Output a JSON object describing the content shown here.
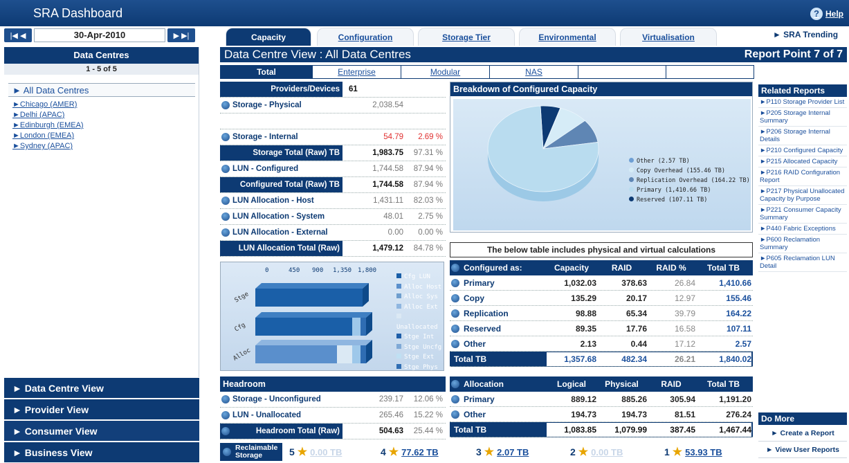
{
  "app": {
    "title": "SRA Dashboard",
    "help": "Help"
  },
  "date": "30-Apr-2010",
  "tabs": [
    "Capacity",
    "Configuration",
    "Storage Tier",
    "Environmental",
    "Virtualisation"
  ],
  "trending": "► SRA Trending",
  "left": {
    "header": "Data Centres",
    "count": "1 - 5 of 5",
    "all": "► All Data Centres",
    "locations": [
      "►Chicago (AMER)",
      "►Delhi (APAC)",
      "►Edinburgh (EMEA)",
      "►London (EMEA)",
      "►Sydney (APAC)"
    ],
    "views": [
      "► Data Centre View",
      "► Provider View",
      "► Consumer View",
      "► Business View"
    ]
  },
  "view_title": "Data Centre View : All Data Centres",
  "report_point": "Report Point  7  of  7",
  "subtabs": [
    "Total",
    "Enterprise",
    "Modular",
    "NAS",
    "",
    ""
  ],
  "main": {
    "providers_label": "Providers/Devices",
    "providers_value": "61",
    "rows": [
      {
        "label": "Storage - Physical",
        "v1": "2,038.54",
        "v2": ""
      },
      {
        "label": "Storage - Internal",
        "v1": "54.79",
        "v2": "2.69 %"
      },
      {
        "label": "Storage Total (Raw) TB",
        "v1": "1,983.75",
        "v2": "97.31 %"
      },
      {
        "label": "LUN - Configured",
        "v1": "1,744.58",
        "v2": "87.94 %"
      },
      {
        "label": "Configured Total (Raw) TB",
        "v1": "1,744.58",
        "v2": "87.94 %"
      },
      {
        "label": "LUN Allocation - Host",
        "v1": "1,431.11",
        "v2": "82.03 %"
      },
      {
        "label": "LUN Allocation - System",
        "v1": "48.01",
        "v2": "2.75 %"
      },
      {
        "label": "LUN Allocation - External",
        "v1": "0.00",
        "v2": "0.00 %"
      },
      {
        "label": "LUN Allocation Total (Raw)",
        "v1": "1,479.12",
        "v2": "84.78 %"
      }
    ]
  },
  "breakdown": {
    "title": "Breakdown of Configured Capacity",
    "legend": [
      "Other (2.57 TB)",
      "Copy Overhead (155.46 TB)",
      "Replication Overhead (164.22 TB)",
      "Primary (1,410.66 TB)",
      "Reserved (107.11 TB)"
    ],
    "colors": [
      "#6e9fd4",
      "#d6ecf7",
      "#5f86b4",
      "#b9dcef",
      "#0d3a73"
    ]
  },
  "chart_data": {
    "type": "pie",
    "title": "Breakdown of Configured Capacity",
    "categories": [
      "Other",
      "Copy Overhead",
      "Replication Overhead",
      "Primary",
      "Reserved"
    ],
    "values": [
      2.57,
      155.46,
      164.22,
      1410.66,
      107.11
    ]
  },
  "bar": {
    "ticks": [
      "0",
      "450",
      "900",
      "1,350",
      "1,800"
    ],
    "cats": [
      "Stge",
      "Cfg",
      "Alloc"
    ],
    "legend": [
      "Cfg LUN",
      "Alloc Host",
      "Alloc Sys",
      "Alloc Ext",
      "Unallocated",
      "Stge Int",
      "Stge Uncfg",
      "Stge Ext",
      "Stge Phys"
    ],
    "colors": [
      "#1a5fa8",
      "#5a8fcc",
      "#6e9ece",
      "#8fb6e0",
      "#dbe9f4",
      "#1e5ea9",
      "#7fa9d6",
      "#bfe0f3",
      "#2f6db3"
    ]
  },
  "note": "The below table includes physical and virtual calculations",
  "configured": {
    "headers": [
      "Configured as:",
      "Capacity",
      "RAID",
      "RAID %",
      "Total TB"
    ],
    "rows": [
      [
        "Primary",
        "1,032.03",
        "378.63",
        "26.84",
        "1,410.66"
      ],
      [
        "Copy",
        "135.29",
        "20.17",
        "12.97",
        "155.46"
      ],
      [
        "Replication",
        "98.88",
        "65.34",
        "39.79",
        "164.22"
      ],
      [
        "Reserved",
        "89.35",
        "17.76",
        "16.58",
        "107.11"
      ],
      [
        "Other",
        "2.13",
        "0.44",
        "17.12",
        "2.57"
      ]
    ],
    "total": [
      "Total TB",
      "1,357.68",
      "482.34",
      "26.21",
      "1,840.02"
    ]
  },
  "allocation": {
    "headers": [
      "Allocation",
      "Logical",
      "Physical",
      "RAID",
      "Total TB"
    ],
    "rows": [
      [
        "Primary",
        "889.12",
        "885.26",
        "305.94",
        "1,191.20"
      ],
      [
        "Other",
        "194.73",
        "194.73",
        "81.51",
        "276.24"
      ]
    ],
    "total": [
      "Total TB",
      "1,083.85",
      "1,079.99",
      "387.45",
      "1,467.44"
    ]
  },
  "headroom": {
    "title": "Headroom",
    "rows": [
      {
        "label": "Storage - Unconfigured",
        "v1": "239.17",
        "v2": "12.06 %"
      },
      {
        "label": "LUN - Unallocated",
        "v1": "265.46",
        "v2": "15.22 %"
      },
      {
        "label": "Headroom Total (Raw)",
        "v1": "504.63",
        "v2": "25.44 %"
      }
    ]
  },
  "reclaim": {
    "label": "Reclaimable Storage",
    "items": [
      {
        "n": "5",
        "v": "0.00 TB"
      },
      {
        "n": "4",
        "v": "77.62 TB"
      },
      {
        "n": "3",
        "v": "2.07 TB"
      },
      {
        "n": "2",
        "v": "0.00 TB"
      },
      {
        "n": "1",
        "v": "53.93 TB"
      }
    ]
  },
  "related": {
    "title": "Related Reports",
    "items": [
      "►P110 Storage Provider List",
      "►P205 Storage Internal Summary",
      "►P206 Storage Internal Details",
      "►P210 Configured Capacity",
      "►P215 Allocated Capacity",
      "►P216 RAID Configuration Report",
      "►P217 Physical Unallocated Capacity by Purpose",
      "►P221 Consumer Capacity Summary",
      "►P440 Fabric Exceptions",
      "►P600 Reclamation Summary",
      "►P605 Reclamation LUN Detail"
    ]
  },
  "domore": {
    "title": "Do More",
    "items": [
      "► Create a Report",
      "► View User Reports"
    ]
  }
}
